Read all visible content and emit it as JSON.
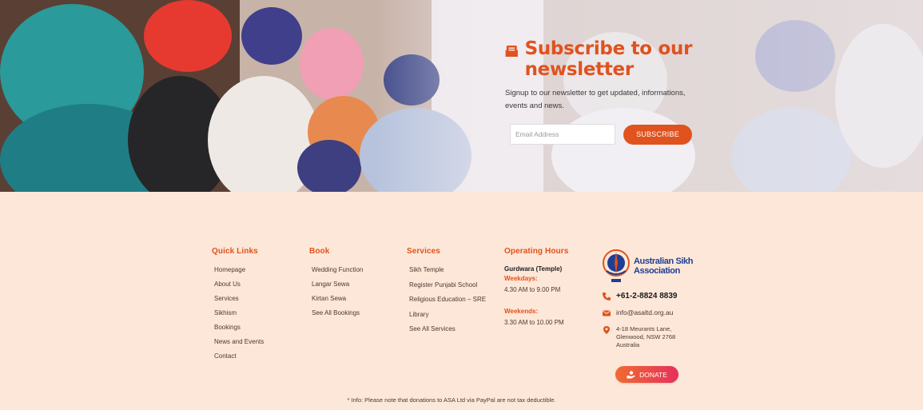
{
  "newsletter": {
    "title": "Subscribe to our newsletter",
    "description": "Signup to our newsletter to get updated, informations, events and news.",
    "email_placeholder": "Email Address",
    "button_label": "SUBSCRIBE",
    "icon": "envelope-open-icon"
  },
  "footer": {
    "quick_links": {
      "heading": "Quick Links",
      "items": [
        "Homepage",
        "About Us",
        "Services",
        "Sikhism",
        "Bookings",
        "News and Events",
        "Contact"
      ]
    },
    "book": {
      "heading": "Book",
      "items": [
        "Wedding Function",
        "Langar Sewa",
        "Kirtan Sewa",
        "See All Bookings"
      ]
    },
    "services": {
      "heading": "Services",
      "items": [
        "Sikh Temple",
        "Register Punjabi School",
        "Religious Education – SRE",
        "Library",
        "See All Services"
      ]
    },
    "hours": {
      "heading": "Operating Hours",
      "subheading": "Gurdwara (Temple)",
      "weekdays_label": "Weekdays:",
      "weekdays_value": "4.30 AM to 9.00 PM",
      "weekends_label": "Weekends:",
      "weekends_value": "3.30 AM to 10.00 PM"
    },
    "org": {
      "logo_line1": "Australian Sikh",
      "logo_line2": "Association",
      "phone": "+61-2-8824 8839",
      "email": "info@asaltd.org.au",
      "address": "4-18 Meurants Lane, Glenwood, NSW 2768 Australia",
      "donate_label": "DONATE"
    },
    "note": "* Info: Please note that donations to ASA Ltd via PayPal are not tax deductible."
  },
  "colors": {
    "accent": "#e0521e",
    "footer_bg": "#fde7d8",
    "logo_blue": "#1f3f93"
  }
}
